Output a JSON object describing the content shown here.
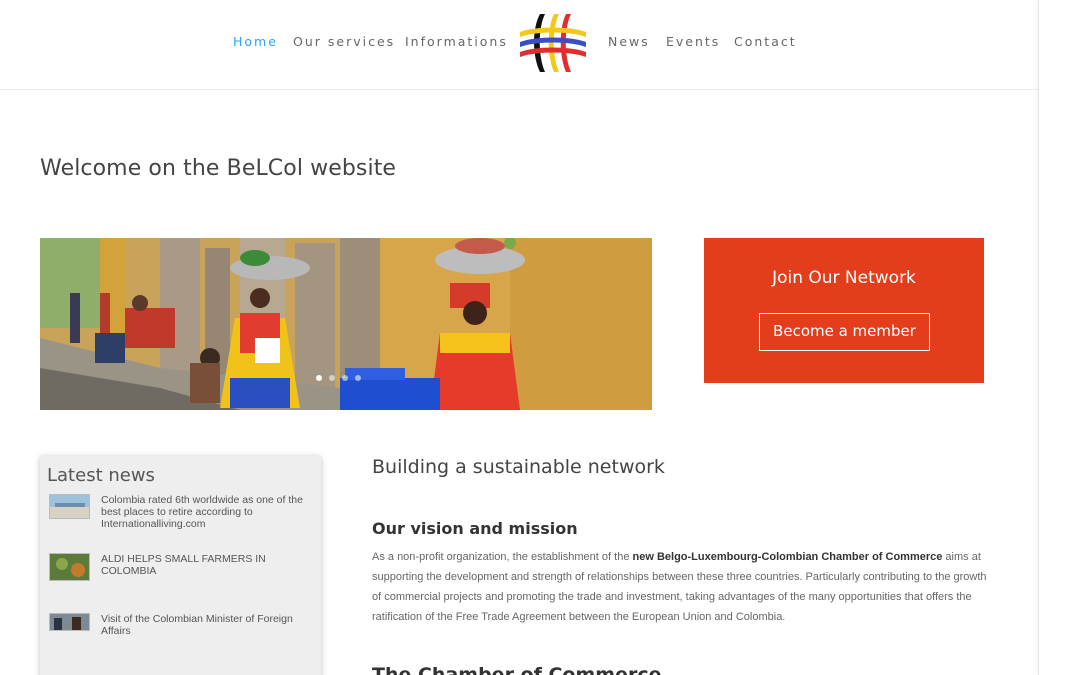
{
  "nav": {
    "home": "Home",
    "services": "Our services",
    "informations": "Informations",
    "news": "News",
    "events": "Events",
    "contact": "Contact"
  },
  "colors": {
    "accent": "#2ea3f2",
    "cta_bg": "#e43d1c",
    "logo_yellow": "#f4c81b",
    "logo_blue": "#3a4fc4",
    "logo_red": "#e02d2d",
    "logo_black": "#111111"
  },
  "welcome": "Welcome on the BeLCol website",
  "slider": {
    "slide_count": 4,
    "active_slide": 1
  },
  "cta": {
    "title": "Join Our Network",
    "button": "Become a member"
  },
  "news": {
    "title": "Latest news",
    "items": [
      {
        "text": "Colombia rated 6th worldwide as one of the best places to retire according to Internationalliving.com",
        "thumb": "beach-thumbnail"
      },
      {
        "text": "ALDI HELPS SMALL FARMERS IN COLOMBIA",
        "thumb": "farm-thumbnail"
      },
      {
        "text": "Visit of the Colombian Minister of Foreign Affairs",
        "thumb": "meeting-thumbnail"
      }
    ]
  },
  "content": {
    "heading": "Building a sustainable network",
    "subheading": "Our vision and mission",
    "para_pre": "As a non-profit organization, the establishment of the ",
    "para_bold": "new Belgo-Luxembourg-Colombian Chamber of Commerce",
    "para_post": " aims at supporting the development and strength of relationships between these three countries. Particularly contributing to the growth of commercial projects and promoting the trade and investment, taking advantages of the many opportunities that offers the ratification of the Free Trade Agreement between the European Union and Colombia.",
    "next_heading": "The Chamber of Commerce"
  }
}
